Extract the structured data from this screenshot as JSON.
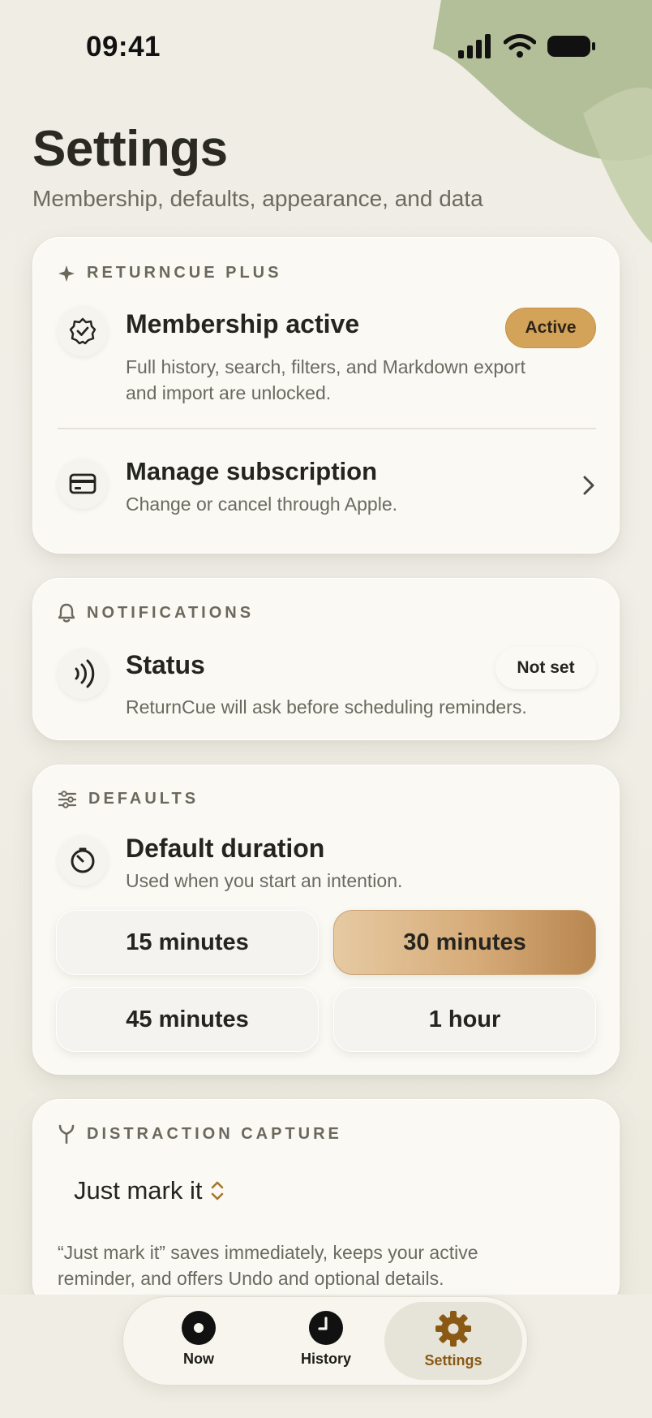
{
  "status_bar": {
    "time": "09:41"
  },
  "header": {
    "title": "Settings",
    "subtitle": "Membership, defaults, appearance, and data"
  },
  "plus": {
    "section_label": "RETURNCUE PLUS",
    "membership_title": "Membership active",
    "membership_badge": "Active",
    "membership_desc_line1": "Full history, search, filters, and Markdown export",
    "membership_desc_line2": "and import are unlocked.",
    "manage_title": "Manage subscription",
    "manage_sub": "Change or cancel through Apple."
  },
  "notifications": {
    "section_label": "NOTIFICATIONS",
    "status_title": "Status",
    "status_badge": "Not set",
    "status_desc": "ReturnCue will ask before scheduling reminders."
  },
  "defaults": {
    "section_label": "DEFAULTS",
    "duration_title": "Default duration",
    "duration_sub": "Used when you start an intention.",
    "options": [
      "15 minutes",
      "30 minutes",
      "45 minutes",
      "1 hour"
    ],
    "selected": "30 minutes"
  },
  "distraction": {
    "section_label": "DISTRACTION CAPTURE",
    "picker_value": "Just mark it",
    "desc_line1": "“Just mark it” saves immediately, keeps your active",
    "desc_line2": "reminder, and offers Undo and optional details."
  },
  "tab_bar": {
    "tabs": [
      {
        "label": "Now",
        "icon": "record-icon"
      },
      {
        "label": "History",
        "icon": "clock-icon"
      },
      {
        "label": "Settings",
        "icon": "gear-icon"
      }
    ],
    "active": "Settings"
  },
  "colors": {
    "accent": "#d4a35a",
    "accent_text": "#8a5a14",
    "leaf_green": "#a9b88f",
    "background": "#efede4"
  }
}
